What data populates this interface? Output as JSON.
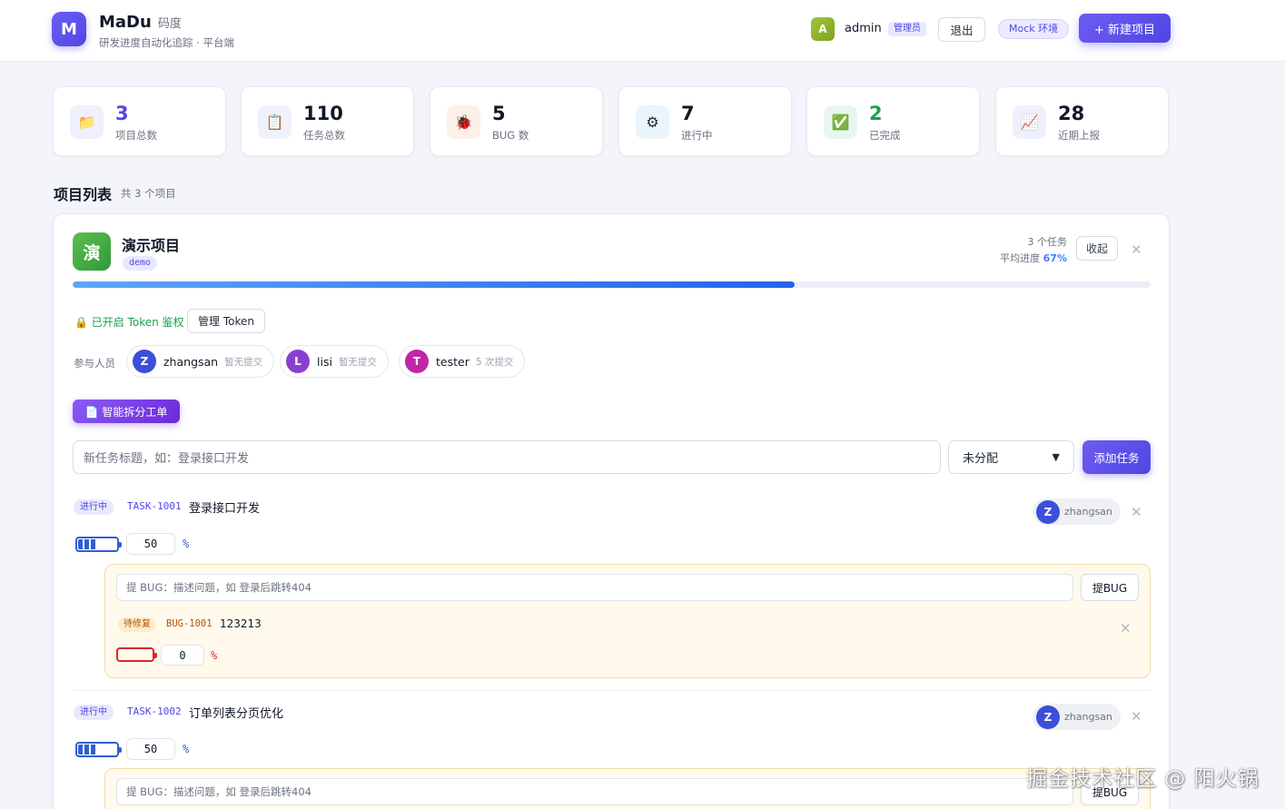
{
  "header": {
    "logo_letter": "M",
    "brand_name": "MaDu",
    "brand_sub": "码度",
    "tagline": "研发进度自动化追踪 · 平台端",
    "user_initial": "A",
    "user_name": "admin",
    "role_badge": "管理员",
    "logout_label": "退出",
    "env_badge": "Mock 环境",
    "new_project_label": "+ 新建项目"
  },
  "stats": [
    {
      "icon": "folder-icon",
      "glyph": "📁",
      "value": "3",
      "label": "项目总数",
      "color": "#4f46e5",
      "bg": "#eef0fb"
    },
    {
      "icon": "clipboard-icon",
      "glyph": "📋",
      "value": "110",
      "label": "任务总数",
      "color": "#111827",
      "bg": "#eef2fb"
    },
    {
      "icon": "bug-icon",
      "glyph": "🐞",
      "value": "5",
      "label": "BUG 数",
      "color": "#111827",
      "bg": "#fdf0e8"
    },
    {
      "icon": "gear-icon",
      "glyph": "⚙",
      "value": "7",
      "label": "进行中",
      "color": "#111827",
      "bg": "#eaf4fb"
    },
    {
      "icon": "check-icon",
      "glyph": "✅",
      "value": "2",
      "label": "已完成",
      "color": "#16a34a",
      "bg": "#e8f7ee"
    },
    {
      "icon": "chart-icon",
      "glyph": "📈",
      "value": "28",
      "label": "近期上报",
      "color": "#111827",
      "bg": "#eef0fb"
    }
  ],
  "section": {
    "title": "项目列表",
    "count": "共 3 个项目"
  },
  "project": {
    "icon_char": "演",
    "name": "演示项目",
    "key": "demo",
    "task_count": "3 个任务",
    "avg_label": "平均进度",
    "avg_value": "67%",
    "progress": 0.67,
    "collapse_label": "收起",
    "token_status": "🔒 已开启 Token 鉴权",
    "token_button": "管理 Token",
    "members_label": "参与人员",
    "members": [
      {
        "initial": "Z",
        "name": "zhangsan",
        "sub": "暂无提交",
        "color": "#3b4fd8"
      },
      {
        "initial": "L",
        "name": "lisi",
        "sub": "暂无提交",
        "color": "#8b3fd1"
      },
      {
        "initial": "T",
        "name": "tester",
        "sub": "5 次提交",
        "color": "#c026a8"
      }
    ],
    "split_button": "📄 智能拆分工单",
    "task_placeholder": "新任务标题，如：登录接口开发",
    "assignee_select": "未分配",
    "add_task_label": "添加任务"
  },
  "tasks": [
    {
      "status": "进行中",
      "id": "TASK-1001",
      "title": "登录接口开发",
      "assignee_initial": "Z",
      "assignee": "zhangsan",
      "progress_value": "50",
      "progress": 0.5,
      "pct": "%",
      "bug_placeholder": "提 BUG：描述问题，如 登录后跳转404",
      "bug_button": "提BUG",
      "bugs": [
        {
          "status": "待修复",
          "id": "BUG-1001",
          "title": "123213",
          "progress_value": "0",
          "progress": 0,
          "pct": "%"
        }
      ]
    },
    {
      "status": "进行中",
      "id": "TASK-1002",
      "title": "订单列表分页优化",
      "assignee_initial": "Z",
      "assignee": "zhangsan",
      "progress_value": "50",
      "progress": 0.5,
      "pct": "%",
      "bug_placeholder": "提 BUG：描述问题，如 登录后跳转404",
      "bug_button": "提BUG",
      "bugs": []
    }
  ],
  "watermark": "掘金技术社区 @ 阳火锅"
}
